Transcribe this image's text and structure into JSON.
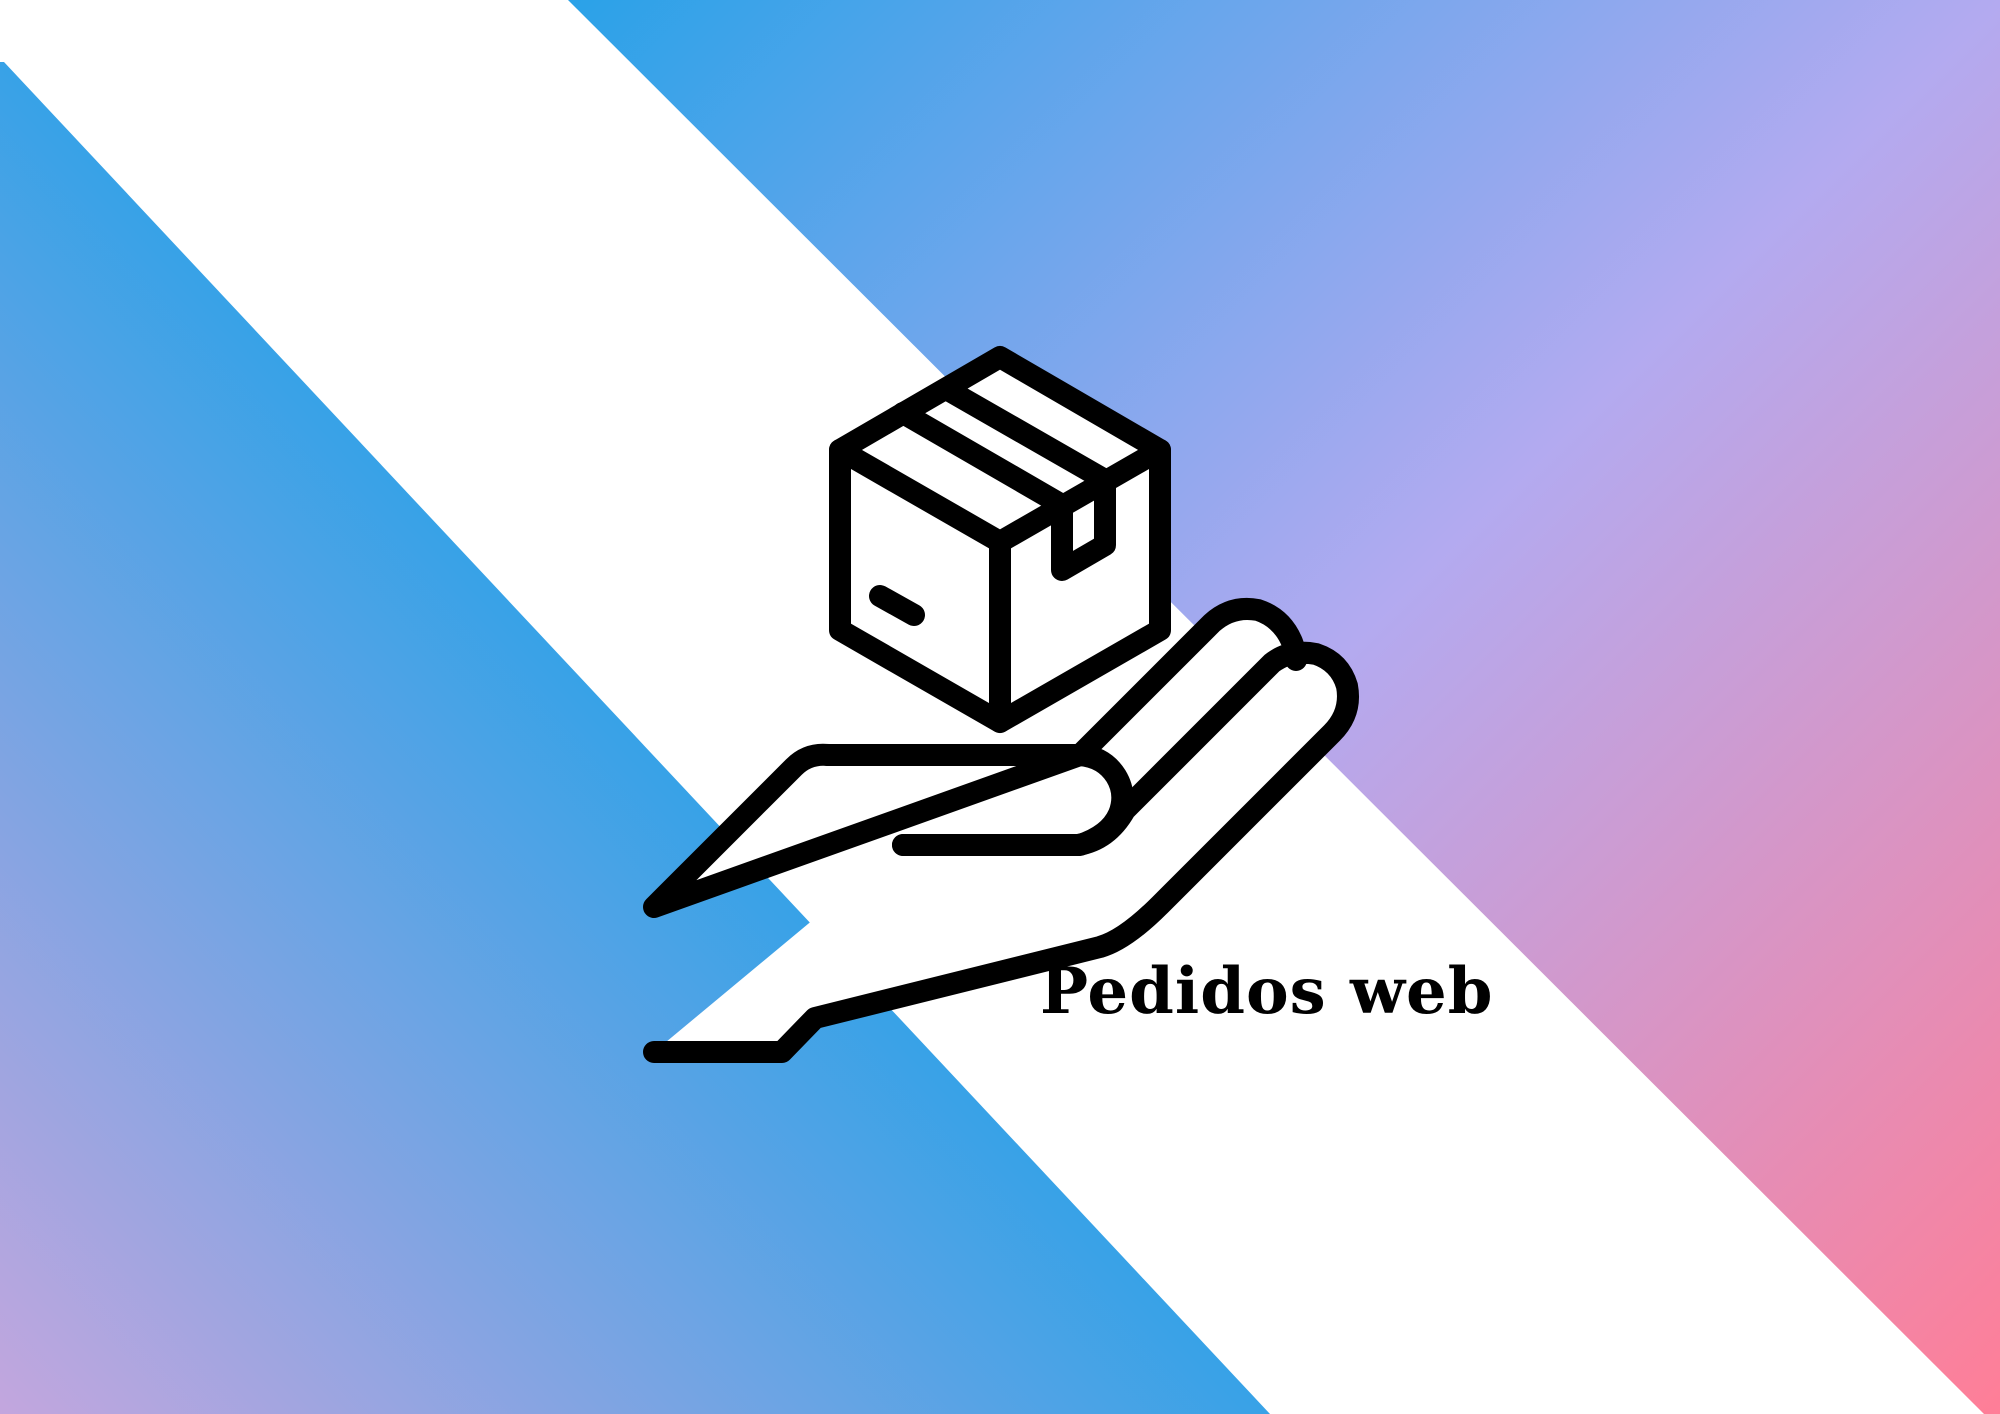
{
  "brand": {
    "name": "Pedidos web",
    "text_color": "#000000"
  },
  "icon": {
    "name": "hand-holding-box-icon",
    "stroke_color": "#000000",
    "fill_color": "#ffffff"
  },
  "background": {
    "base_color": "#ffffff",
    "left_band": {
      "colors": [
        "#c3a6de",
        "#2aa2e8"
      ]
    },
    "right_band": {
      "colors": [
        "#2aa2e8",
        "#b3aaf0",
        "#ff7e97"
      ]
    }
  }
}
